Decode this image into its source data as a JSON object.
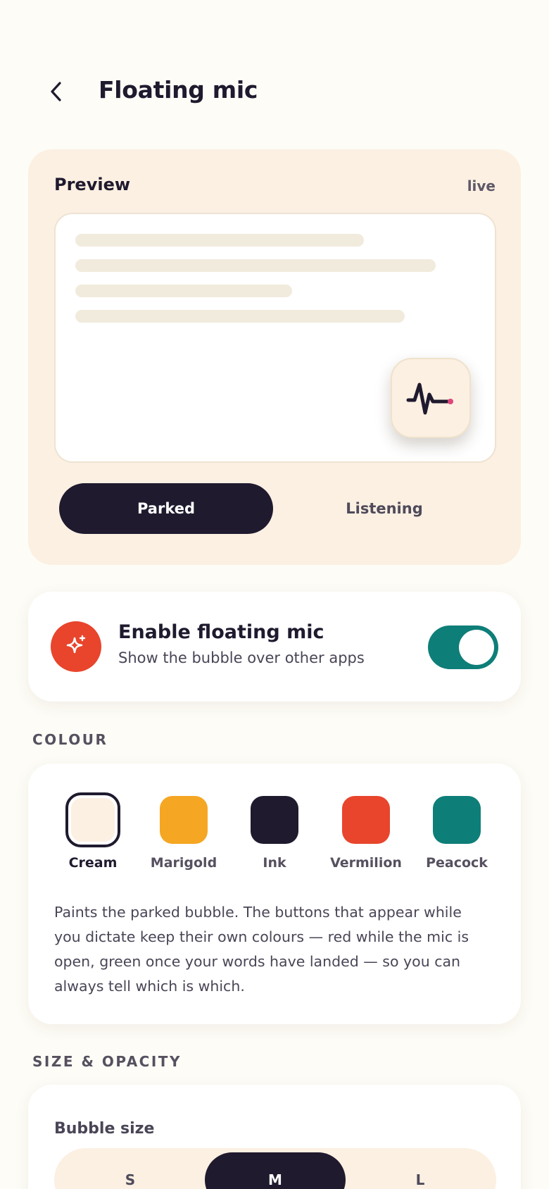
{
  "header": {
    "title": "Floating mic",
    "back_icon": "back-chevron-icon"
  },
  "preview": {
    "title": "Preview",
    "status": "live",
    "bubble_icon": "waveform-icon",
    "modes": [
      {
        "label": "Parked",
        "selected": true
      },
      {
        "label": "Listening",
        "selected": false
      }
    ]
  },
  "enable": {
    "icon": "sparkle-icon",
    "title": "Enable floating mic",
    "subtitle": "Show the bubble over other apps",
    "enabled": true
  },
  "colour": {
    "section_label": "COLOUR",
    "swatches": [
      {
        "label": "Cream",
        "color": "#FBF0E2",
        "selected": true
      },
      {
        "label": "Marigold",
        "color": "#F5A623",
        "selected": false
      },
      {
        "label": "Ink",
        "color": "#1F1A2E",
        "selected": false
      },
      {
        "label": "Vermilion",
        "color": "#E8452C",
        "selected": false
      },
      {
        "label": "Peacock",
        "color": "#0E7E78",
        "selected": false
      }
    ],
    "description": "Paints the parked bubble. The buttons that appear while you dictate keep their own colours — red while the mic is open, green once your words have landed — so you can always tell which is which."
  },
  "size_opacity": {
    "section_label": "SIZE & OPACITY",
    "bubble_size_label": "Bubble size",
    "sizes": [
      {
        "label": "S",
        "selected": false
      },
      {
        "label": "M",
        "selected": true
      },
      {
        "label": "L",
        "selected": false
      }
    ]
  },
  "colors": {
    "ink": "#1F1A2E",
    "cream": "#FBF0E2",
    "accent_red": "#E8452C",
    "accent_teal": "#0E7E78",
    "mic_dot": "#E0457B"
  }
}
